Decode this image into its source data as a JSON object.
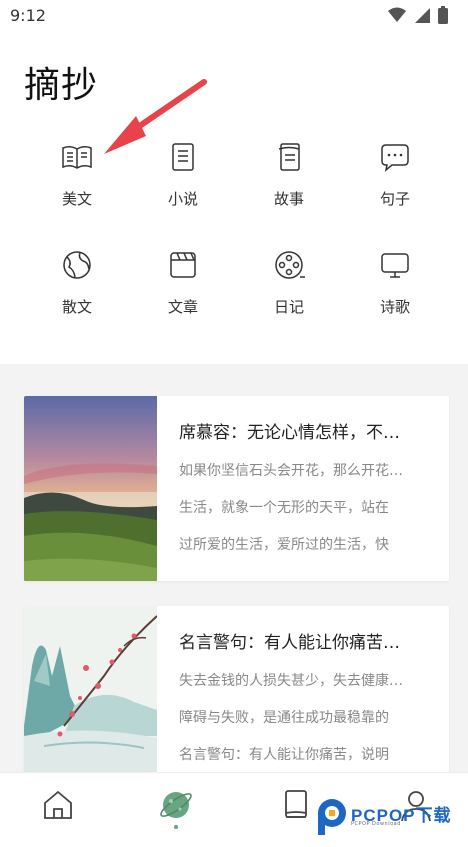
{
  "status": {
    "time": "9:12"
  },
  "header": {
    "title": "摘抄"
  },
  "categories": [
    {
      "label": "美文",
      "icon": "book-open-icon"
    },
    {
      "label": "小说",
      "icon": "document-icon"
    },
    {
      "label": "故事",
      "icon": "notebook-icon"
    },
    {
      "label": "句子",
      "icon": "chat-bubble-icon"
    },
    {
      "label": "散文",
      "icon": "globe-icon"
    },
    {
      "label": "文章",
      "icon": "clapperboard-icon"
    },
    {
      "label": "日记",
      "icon": "film-reel-icon"
    },
    {
      "label": "诗歌",
      "icon": "monitor-icon"
    }
  ],
  "cards": [
    {
      "title": "席慕容：无论心情怎样，不…",
      "lines": [
        "如果你坚信石头会开花，那么开花…",
        "生活，就象一个无形的天平，站在",
        "过所爱的生活，爱所过的生活，快"
      ]
    },
    {
      "title": "名言警句：有人能让你痛苦…",
      "lines": [
        "失去金钱的人损失甚少，失去健康…",
        "障碍与失败，是通往成功最稳靠的",
        "名言警句：有人能让你痛苦，说明"
      ]
    }
  ],
  "bottom_nav": [
    {
      "name": "home",
      "icon": "home-icon"
    },
    {
      "name": "discover",
      "icon": "planet-icon"
    },
    {
      "name": "library",
      "icon": "book-icon"
    },
    {
      "name": "profile",
      "icon": "user-icon"
    }
  ],
  "watermark": {
    "text": "PCPOP下载",
    "sub": "PCPOP Download"
  },
  "colors": {
    "accent": "#6aa583",
    "arrow": "#e8434a",
    "watermark": "#1d67c2"
  }
}
